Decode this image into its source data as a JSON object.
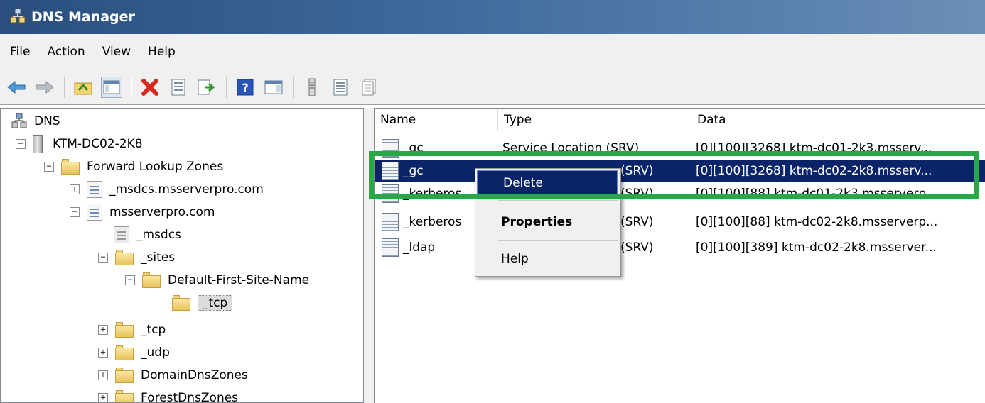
{
  "window": {
    "title": "DNS Manager"
  },
  "menu": [
    "File",
    "Action",
    "View",
    "Help"
  ],
  "toolbar": {
    "icons": [
      "back-arrow-icon",
      "forward-arrow-icon",
      "up-folder-icon",
      "show-hide-tree-icon",
      "delete-icon",
      "properties-icon",
      "export-list-icon",
      "help-icon",
      "action-pane-icon",
      "server-icon",
      "list-icon",
      "doc-icon"
    ]
  },
  "tree": {
    "root": "DNS",
    "server": "KTM-DC02-2K8",
    "forward_zones": "Forward Lookup Zones",
    "zone_msdcs": "_msdcs.msserverpro.com",
    "zone_main": "msserverpro.com",
    "sub_msdcs": "_msdcs",
    "sub_sites": "_sites",
    "site_name": "Default-First-Site-Name",
    "site_tcp": "_tcp",
    "tcp": "_tcp",
    "udp": "_udp",
    "domain_dns_zones": "DomainDnsZones",
    "forest_dns_zones": "ForestDnsZones"
  },
  "list": {
    "columns": [
      "Name",
      "Type",
      "Data"
    ],
    "rows": [
      {
        "name": "_gc",
        "type": "Service Location (SRV)",
        "data": "[0][100][3268] ktm-dc01-2k3.msserv..."
      },
      {
        "name": "_gc",
        "type": "(SRV)",
        "data": "[0][100][3268] ktm-dc02-2k8.msserv..."
      },
      {
        "name": "_kerberos",
        "type": "(SRV)",
        "data": "[0][100][88] ktm-dc01-2k3.msserverp..."
      },
      {
        "name": "_kerberos",
        "type": "(SRV)",
        "data": "[0][100][88] ktm-dc02-2k8.msserverp..."
      },
      {
        "name": "_ldap",
        "type": "(SRV)",
        "data": "[0][100][389] ktm-dc02-2k8.msserver..."
      }
    ]
  },
  "context_menu": {
    "delete": "Delete",
    "properties": "Properties",
    "help": "Help"
  },
  "colors": {
    "highlight_box": "#27a844",
    "selection": "#0a246a",
    "title_bar": "#2a4f7e"
  }
}
